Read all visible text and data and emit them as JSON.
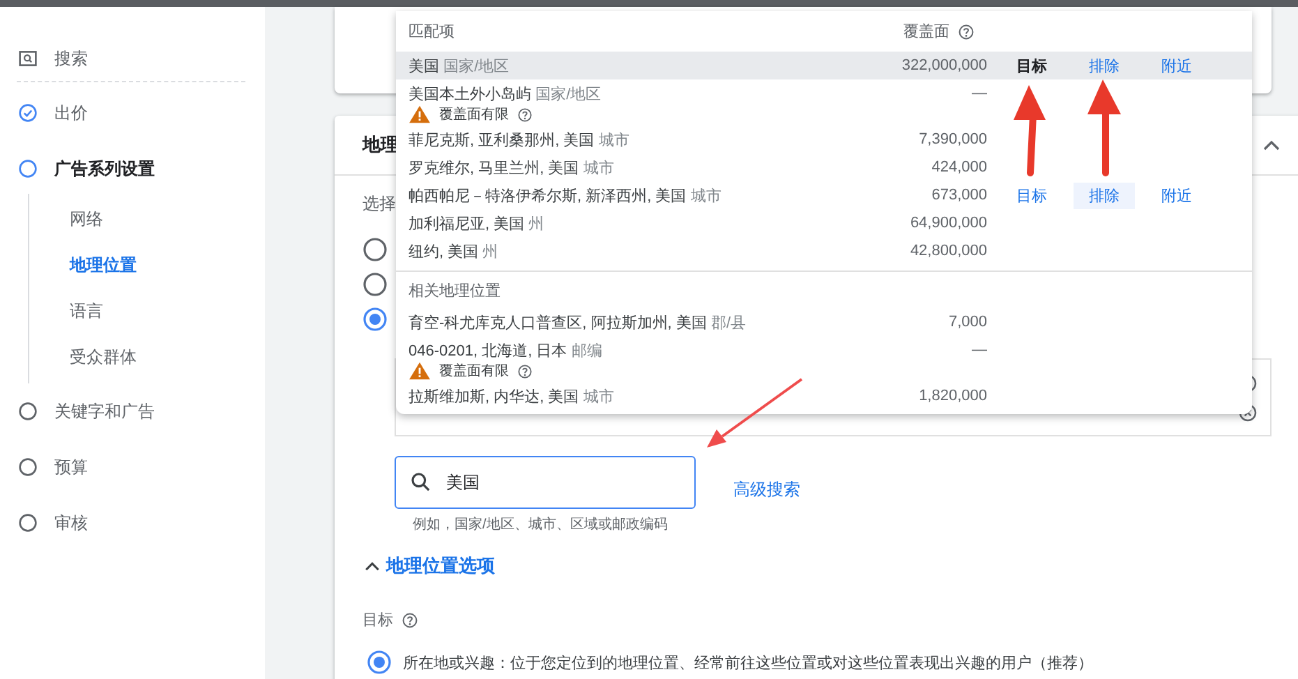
{
  "sidebar": {
    "items": [
      {
        "label": "搜索",
        "kind": "search",
        "selected": false
      },
      {
        "label": "出价",
        "kind": "done",
        "selected": false
      },
      {
        "label": "广告系列设置",
        "kind": "step",
        "selected": true,
        "children": [
          {
            "label": "网络",
            "selected": false
          },
          {
            "label": "地理位置",
            "selected": true
          },
          {
            "label": "语言",
            "selected": false
          },
          {
            "label": "受众群体",
            "selected": false
          }
        ]
      },
      {
        "label": "关键字和广告",
        "kind": "step",
        "selected": false
      },
      {
        "label": "预算",
        "kind": "step",
        "selected": false
      },
      {
        "label": "审核",
        "kind": "step",
        "selected": false
      }
    ]
  },
  "location_card": {
    "title": "地理",
    "intro": "选择",
    "expanded": true,
    "radio_options": [
      {
        "selected": false
      },
      {
        "selected": false
      },
      {
        "selected": true
      }
    ],
    "selected_locations": [
      {
        "removable": true
      },
      {
        "removable": true
      }
    ],
    "search": {
      "value": "美国",
      "hint": "例如，国家/地区、城市、区域或邮政编码"
    },
    "advanced_search": "高级搜索",
    "location_options": {
      "label": "地理位置选项",
      "expanded": true,
      "target_label": "目标",
      "options": [
        {
          "label": "所在地或兴趣：位于您定位到的地理位置、经常前往这些位置或对这些位置表现出兴趣的用户（推荐）",
          "selected": true
        }
      ]
    }
  },
  "suggestions": {
    "header_name": "匹配项",
    "header_coverage": "覆盖面",
    "sections": [
      {
        "rows": [
          {
            "name": "美国",
            "type": "国家/地区",
            "coverage": "322,000,000",
            "highlighted": true,
            "actions": [
              {
                "label": "目标",
                "active": true,
                "hovered": false
              },
              {
                "label": "排除",
                "active": false,
                "hovered": false
              },
              {
                "label": "附近",
                "active": false,
                "hovered": false
              }
            ]
          },
          {
            "name": "美国本土外小岛屿",
            "type": "国家/地区",
            "coverage": "—",
            "highlighted": false,
            "warning": "覆盖面有限"
          },
          {
            "name": "菲尼克斯, 亚利桑那州, 美国",
            "type": "城市",
            "coverage": "7,390,000",
            "highlighted": false
          },
          {
            "name": "罗克维尔, 马里兰州, 美国",
            "type": "城市",
            "coverage": "424,000",
            "highlighted": false
          },
          {
            "name": "帕西帕尼－特洛伊希尔斯, 新泽西州, 美国",
            "type": "城市",
            "coverage": "673,000",
            "highlighted": false,
            "actions": [
              {
                "label": "目标",
                "active": false,
                "hovered": false
              },
              {
                "label": "排除",
                "active": false,
                "hovered": true
              },
              {
                "label": "附近",
                "active": false,
                "hovered": false
              }
            ]
          },
          {
            "name": "加利福尼亚, 美国",
            "type": "州",
            "coverage": "64,900,000",
            "highlighted": false
          },
          {
            "name": "纽约, 美国",
            "type": "州",
            "coverage": "42,800,000",
            "highlighted": false
          }
        ]
      },
      {
        "title": "相关地理位置",
        "rows": [
          {
            "name": "育空-科尤库克人口普查区, 阿拉斯加州, 美国",
            "type": "郡/县",
            "coverage": "7,000",
            "highlighted": false
          },
          {
            "name": "046-0201, 北海道, 日本",
            "type": "邮编",
            "coverage": "—",
            "highlighted": false,
            "warning": "覆盖面有限"
          },
          {
            "name": "拉斯维加斯, 内华达, 美国",
            "type": "城市",
            "coverage": "1,820,000",
            "highlighted": false
          }
        ]
      }
    ]
  }
}
